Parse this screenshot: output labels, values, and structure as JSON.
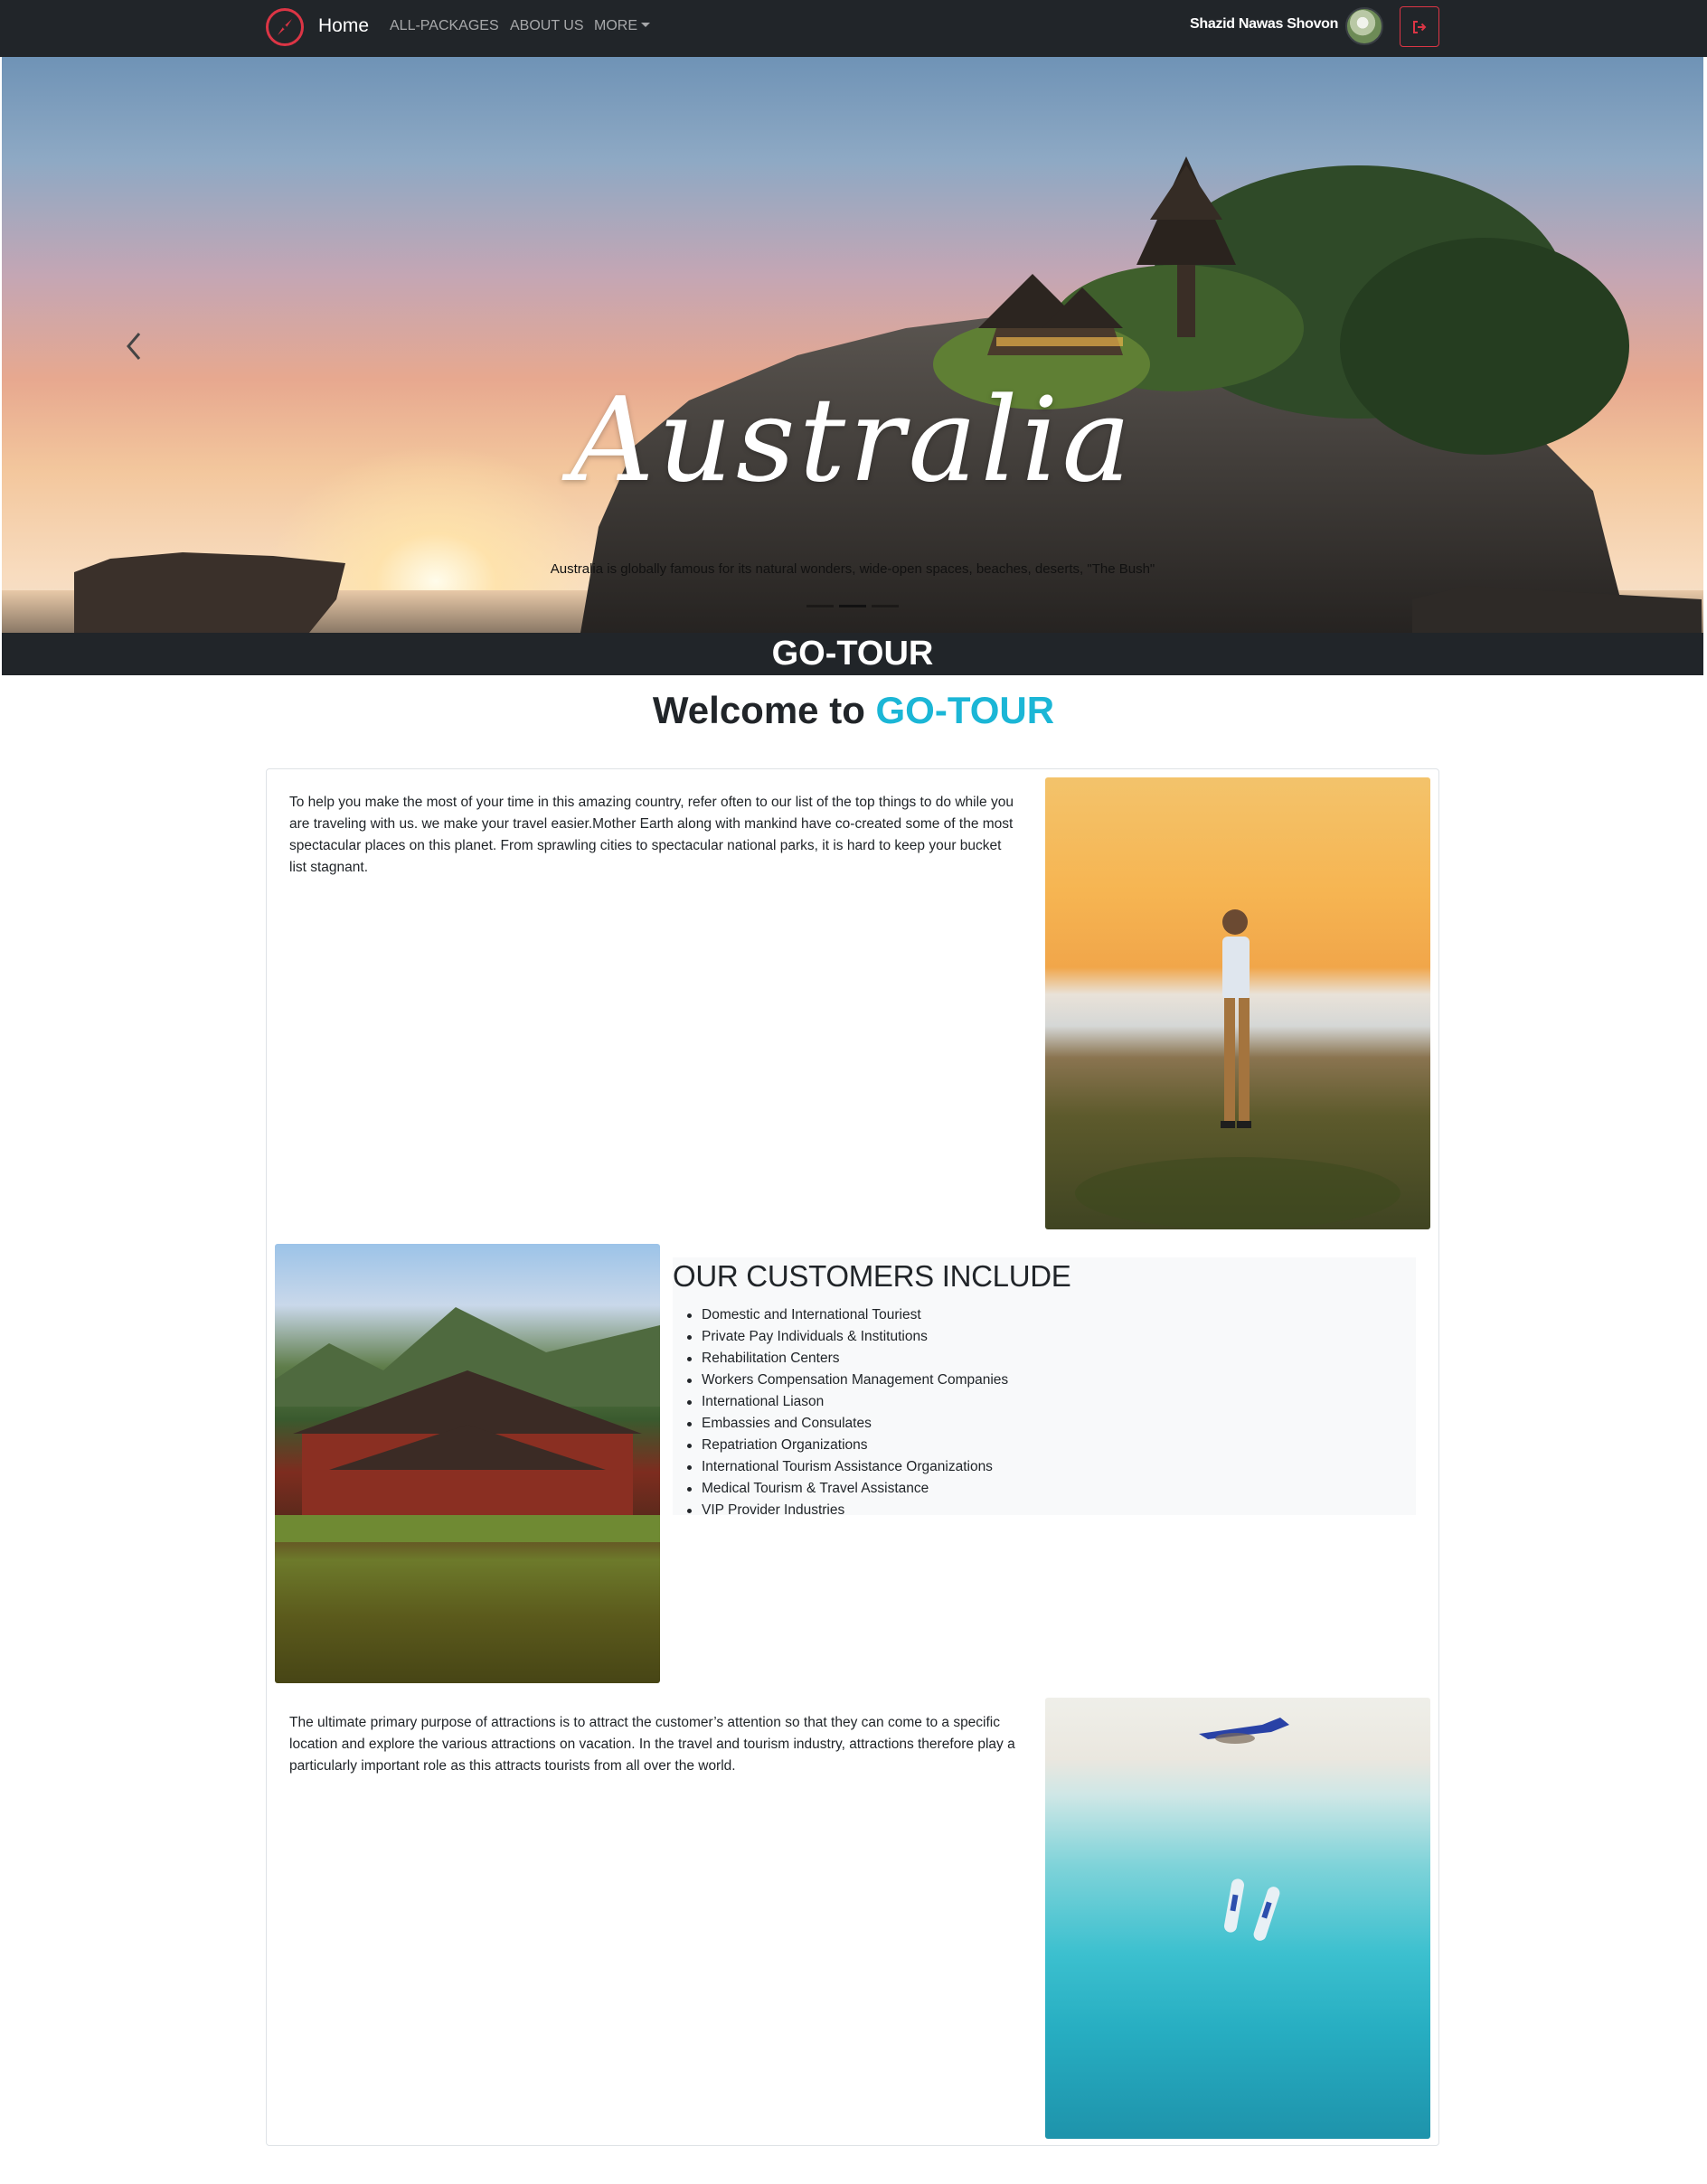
{
  "navbar": {
    "brand_icon": "compass-icon",
    "home": "Home",
    "links": [
      "ALL-PACKAGES",
      "ABOUT US",
      "MORE"
    ],
    "user_name": "Shazid Nawas Shovon",
    "logout_icon": "sign-out-icon"
  },
  "hero": {
    "title": "Australia",
    "caption": "Australia is globally famous for its natural wonders, wide-open spaces, beaches, deserts, \"The Bush\"",
    "active_slide": 2,
    "slide_count": 3,
    "prev_icon": "chevron-left-icon"
  },
  "brand_band": "GO-TOUR",
  "welcome": {
    "prefix": "Welcome to ",
    "accent": "GO-TOUR",
    "accent_color": "#1bb6d6"
  },
  "section1": {
    "text": "To help you make the most of your time in this amazing country, refer often to our list of the top things to do while you are traveling with us. we make your travel easier.Mother Earth along with mankind have co-created some of the most spectacular places on this planet. From sprawling cities to spectacular national parks, it is hard to keep your bucket list stagnant."
  },
  "customers": {
    "title": "OUR CUSTOMERS INCLUDE",
    "items": [
      "Domestic and International Touriest",
      "Private Pay Individuals & Institutions",
      "Rehabilitation Centers",
      "Workers Compensation Management Companies",
      "International Liason",
      "Embassies and Consulates",
      "Repatriation Organizations",
      "International Tourism Assistance Organizations",
      "Medical Tourism & Travel Assistance",
      "VIP Provider Industries"
    ]
  },
  "section3": {
    "text": "The ultimate primary purpose of attractions is to attract the customer’s attention so that they can come to a specific location and explore the various attractions on vacation. In the travel and tourism industry, attractions therefore play a particularly important role as this attracts tourists from all over the world."
  },
  "colors": {
    "navbar": "#212529",
    "logout_border": "#dc3545",
    "accent": "#1bb6d6"
  }
}
